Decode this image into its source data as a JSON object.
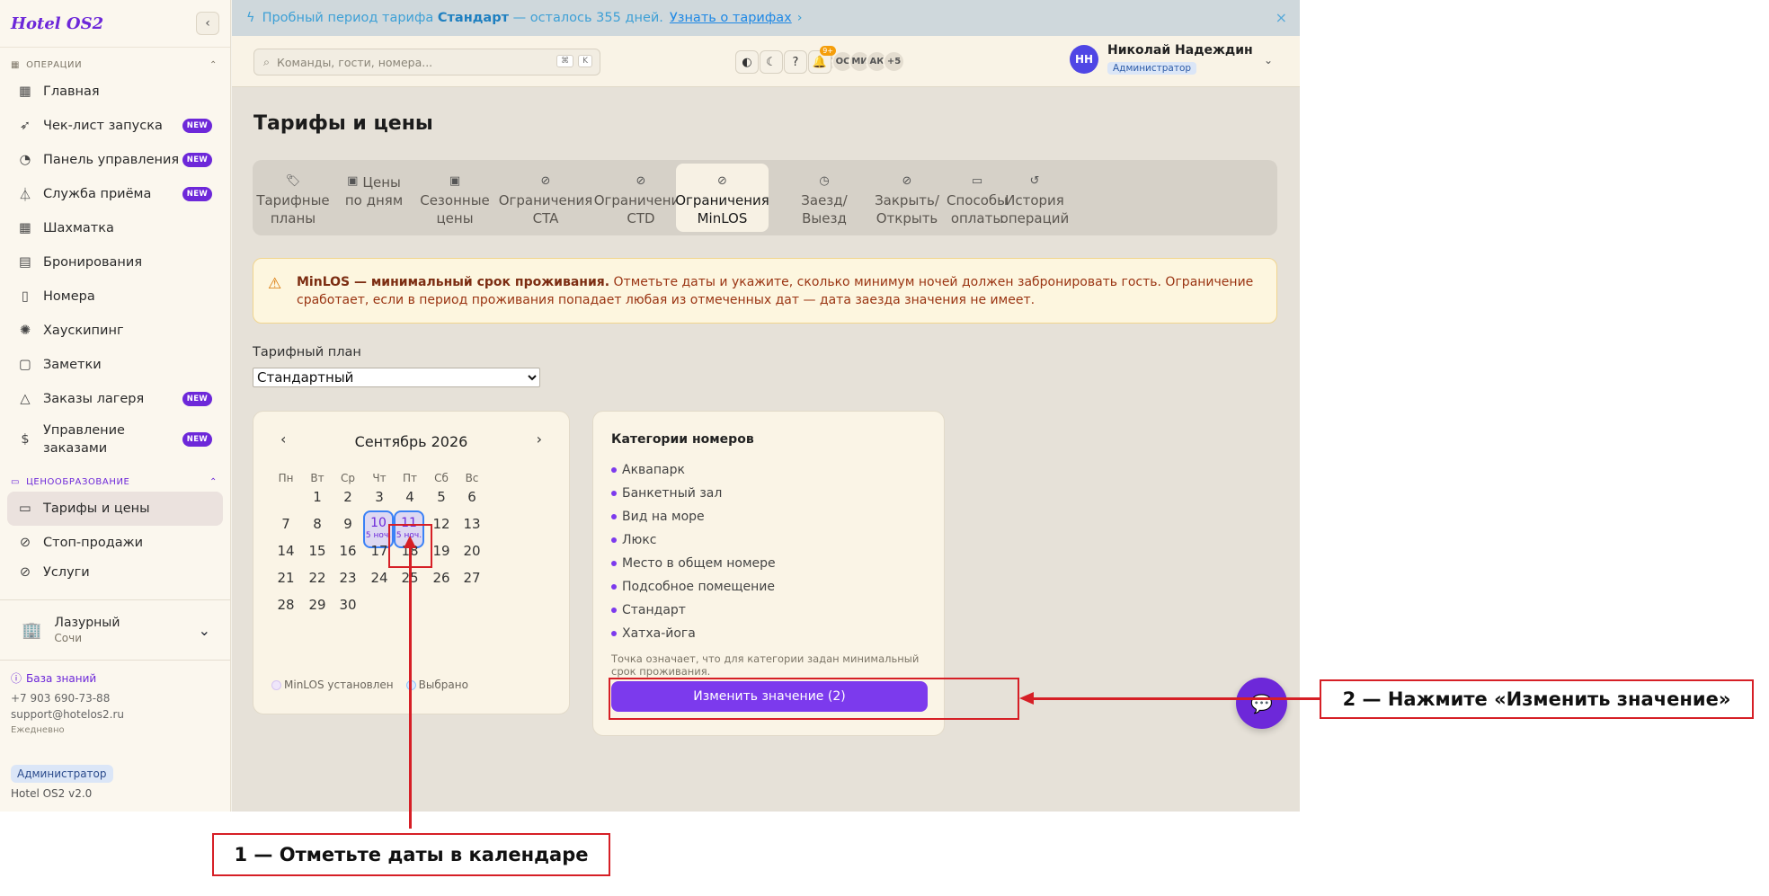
{
  "app": {
    "logo": "Hotel OS2"
  },
  "sidebar": {
    "sections": {
      "operations": "ОПЕРАЦИИ",
      "pricing": "ЦЕНООБРАЗОВАНИЕ"
    },
    "items": [
      {
        "label": "Главная",
        "badge": ""
      },
      {
        "label": "Чек-лист запуска",
        "badge": "NEW"
      },
      {
        "label": "Панель управления",
        "badge": "NEW"
      },
      {
        "label": "Служба приёма",
        "badge": "NEW"
      },
      {
        "label": "Шахматка",
        "badge": ""
      },
      {
        "label": "Бронирования",
        "badge": ""
      },
      {
        "label": "Номера",
        "badge": ""
      },
      {
        "label": "Хаускипинг",
        "badge": ""
      },
      {
        "label": "Заметки",
        "badge": ""
      },
      {
        "label": "Заказы лагеря",
        "badge": "NEW"
      },
      {
        "label": "Управление заказами",
        "badge": "NEW"
      }
    ],
    "pricing_items": [
      {
        "label": "Тарифы и цены"
      },
      {
        "label": "Стоп-продажи"
      },
      {
        "label": "Услуги"
      }
    ],
    "hotel": {
      "name": "Лазурный",
      "city": "Сочи"
    },
    "support": {
      "kb": "База знаний",
      "phone": "+7 903 690-73-88",
      "email": "support@hotelos2.ru",
      "hours": "Ежедневно"
    },
    "role": "Администратор",
    "version": "Hotel OS2 v2.0"
  },
  "trial": {
    "prefix": "Пробный период тарифа",
    "plan": "Стандарт",
    "suffix": "— осталось 355 дней.",
    "link": "Узнать о тарифах",
    "close": "×"
  },
  "header": {
    "search_placeholder": "Команды, гости, номера...",
    "kbd": [
      "⌘",
      "K"
    ],
    "avatars": [
      "ИС",
      "ОС",
      "МИ",
      "АК",
      "+5"
    ],
    "notifications": "9+",
    "user_initials": "НН",
    "user_name": "Николай Надеждин",
    "user_role": "Администратор"
  },
  "page": {
    "title": "Тарифы и цены",
    "tabs": [
      {
        "l1": "Тарифные",
        "l2": "планы",
        "icon": "tag-icon"
      },
      {
        "l1": "Цены",
        "l2": "по дням",
        "icon": "calendar-icon"
      },
      {
        "l1": "Сезонные",
        "l2": "цены",
        "icon": "calendar-icon"
      },
      {
        "l1": "Ограничения",
        "l2": "CTA",
        "icon": "ban-icon"
      },
      {
        "l1": "Ограничения",
        "l2": "CTD",
        "icon": "ban-icon"
      },
      {
        "l1": "Ограничения",
        "l2": "MinLOS",
        "icon": "ban-icon"
      },
      {
        "l1": "Заезд/",
        "l2": "Выезд",
        "icon": "clock-icon"
      },
      {
        "l1": "Закрыть/",
        "l2": "Открыть",
        "icon": "ban-icon"
      },
      {
        "l1": "Способы",
        "l2": "оплаты",
        "icon": "card-icon"
      },
      {
        "l1": "История",
        "l2": "операций",
        "icon": "history-icon"
      }
    ],
    "alert_bold": "MinLOS — минимальный срок проживания.",
    "alert_text": "Отметьте даты и укажите, сколько минимум ночей должен забронировать гость. Ограничение сработает, если в период проживания попадает любая из отмеченных дат — дата заезда значения не имеет.",
    "plan_label": "Тарифный план",
    "plan_value": "Стандартный"
  },
  "calendar": {
    "month": "Сентябрь 2026",
    "dow": [
      "Пн",
      "Вт",
      "Ср",
      "Чт",
      "Пт",
      "Сб",
      "Вс"
    ],
    "selected_note": "5 ноч.",
    "legend_set": "MinLOS установлен",
    "legend_selected": "Выбрано"
  },
  "categories": {
    "title": "Категории номеров",
    "items": [
      "Аквапарк",
      "Банкетный зал",
      "Вид на море",
      "Люкс",
      "Место в общем номере",
      "Подсобное помещение",
      "Стандарт",
      "Хатха-йога"
    ],
    "note": "Точка означает, что для категории задан минимальный срок проживания.",
    "button": "Изменить значение (2)"
  },
  "annotations": {
    "step1": "1 — Отметьте даты в календаре",
    "step2": "2 — Нажмите «Изменить значение»"
  },
  "colors": {
    "accent": "#7c3aed",
    "annotation": "#d61f26"
  }
}
